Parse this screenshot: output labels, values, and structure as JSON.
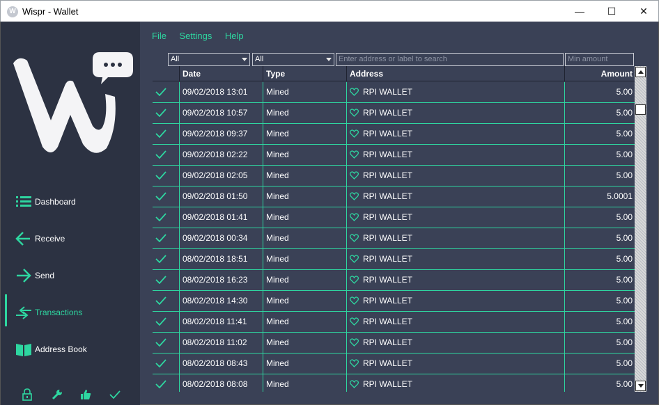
{
  "window": {
    "title": "Wispr - Wallet",
    "app_icon_letter": "W",
    "minimize_label": "—",
    "maximize_label": "☐",
    "close_label": "✕"
  },
  "colors": {
    "accent": "#2ed6a0",
    "sidebar_bg": "#2c3242",
    "main_bg": "#3a4156"
  },
  "menu": {
    "file": "File",
    "settings": "Settings",
    "help": "Help"
  },
  "sidebar": {
    "logo_icon": "wispr-logo",
    "items": [
      {
        "label": "Dashboard",
        "icon": "list-icon",
        "active": false
      },
      {
        "label": "Receive",
        "icon": "arrow-left-icon",
        "active": false
      },
      {
        "label": "Send",
        "icon": "arrow-right-icon",
        "active": false
      },
      {
        "label": "Transactions",
        "icon": "swap-arrows-icon",
        "active": true
      },
      {
        "label": "Address Book",
        "icon": "book-icon",
        "active": false
      }
    ],
    "status_icons": [
      "lock-icon",
      "wrench-icon",
      "thumbs-up-icon",
      "check-icon"
    ]
  },
  "filters": {
    "date_filter": "All",
    "type_filter": "All",
    "search_placeholder": "Enter address or label to search",
    "min_amount_placeholder": "Min amount"
  },
  "table": {
    "columns": {
      "date": "Date",
      "type": "Type",
      "address": "Address",
      "amount": "Amount"
    },
    "rows": [
      {
        "date": "09/02/2018 13:01",
        "type": "Mined",
        "address": "RPI WALLET",
        "amount": "5.00"
      },
      {
        "date": "09/02/2018 10:57",
        "type": "Mined",
        "address": "RPI WALLET",
        "amount": "5.00"
      },
      {
        "date": "09/02/2018 09:37",
        "type": "Mined",
        "address": "RPI WALLET",
        "amount": "5.00"
      },
      {
        "date": "09/02/2018 02:22",
        "type": "Mined",
        "address": "RPI WALLET",
        "amount": "5.00"
      },
      {
        "date": "09/02/2018 02:05",
        "type": "Mined",
        "address": "RPI WALLET",
        "amount": "5.00"
      },
      {
        "date": "09/02/2018 01:50",
        "type": "Mined",
        "address": "RPI WALLET",
        "amount": "5.0001"
      },
      {
        "date": "09/02/2018 01:41",
        "type": "Mined",
        "address": "RPI WALLET",
        "amount": "5.00"
      },
      {
        "date": "09/02/2018 00:34",
        "type": "Mined",
        "address": "RPI WALLET",
        "amount": "5.00"
      },
      {
        "date": "08/02/2018 18:51",
        "type": "Mined",
        "address": "RPI WALLET",
        "amount": "5.00"
      },
      {
        "date": "08/02/2018 16:23",
        "type": "Mined",
        "address": "RPI WALLET",
        "amount": "5.00"
      },
      {
        "date": "08/02/2018 14:30",
        "type": "Mined",
        "address": "RPI WALLET",
        "amount": "5.00"
      },
      {
        "date": "08/02/2018 11:41",
        "type": "Mined",
        "address": "RPI WALLET",
        "amount": "5.00"
      },
      {
        "date": "08/02/2018 11:02",
        "type": "Mined",
        "address": "RPI WALLET",
        "amount": "5.00"
      },
      {
        "date": "08/02/2018 08:43",
        "type": "Mined",
        "address": "RPI WALLET",
        "amount": "5.00"
      },
      {
        "date": "08/02/2018 08:08",
        "type": "Mined",
        "address": "RPI WALLET",
        "amount": "5.00"
      }
    ]
  }
}
